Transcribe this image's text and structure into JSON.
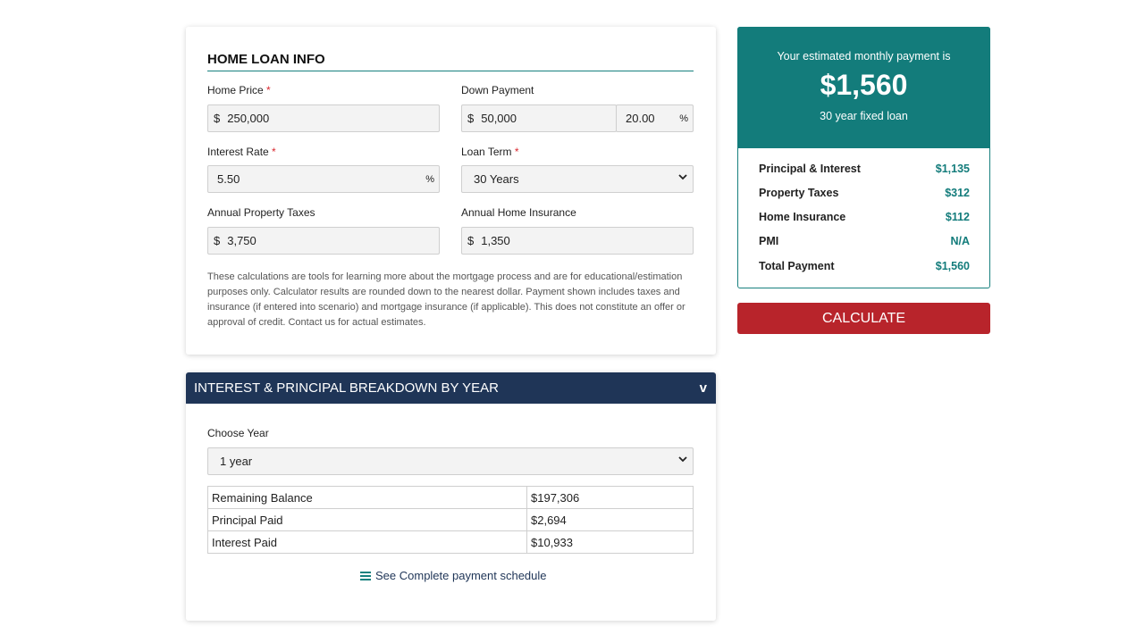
{
  "loan_info": {
    "title": "HOME LOAN INFO",
    "home_price": {
      "label": "Home Price",
      "required": "*",
      "prefix": "$",
      "value": "250,000"
    },
    "down_payment": {
      "label": "Down Payment",
      "prefix": "$",
      "value": "50,000",
      "percent_value": "20.00",
      "suffix": "%"
    },
    "interest_rate": {
      "label": "Interest Rate",
      "required": "*",
      "value": "5.50",
      "suffix": "%"
    },
    "loan_term": {
      "label": "Loan Term",
      "required": "*",
      "selected": "30 Years"
    },
    "property_taxes": {
      "label": "Annual Property Taxes",
      "prefix": "$",
      "value": "3,750"
    },
    "home_insurance": {
      "label": "Annual Home Insurance",
      "prefix": "$",
      "value": "1,350"
    },
    "disclaimer": "These calculations are tools for learning more about the mortgage process and are for educational/estimation purposes only. Calculator results are rounded down to the nearest dollar. Payment shown includes taxes and insurance (if entered into scenario) and mortgage insurance (if applicable). This does not constitute an offer or approval of credit. Contact us for actual estimates."
  },
  "breakdown": {
    "title": "INTEREST & PRINCIPAL BREAKDOWN BY YEAR",
    "toggle": "v",
    "year_label": "Choose Year",
    "year_selected": "1 year",
    "rows": [
      {
        "label": "Remaining Balance",
        "value": "$197,306"
      },
      {
        "label": "Principal Paid",
        "value": "$2,694"
      },
      {
        "label": "Interest Paid",
        "value": "$10,933"
      }
    ],
    "schedule_link": "See Complete payment schedule"
  },
  "summary": {
    "intro": "Your estimated monthly payment is",
    "amount": "$1,560",
    "term": "30 year fixed loan",
    "rows": [
      {
        "label": "Principal & Interest",
        "value": "$1,135"
      },
      {
        "label": "Property Taxes",
        "value": "$312"
      },
      {
        "label": "Home Insurance",
        "value": "$112"
      },
      {
        "label": "PMI",
        "value": "N/A"
      },
      {
        "label": "Total Payment",
        "value": "$1,560"
      }
    ]
  },
  "calculate_label": "CALCULATE",
  "icons": {
    "dropdown": "chevron-down-icon",
    "schedule": "list-icon"
  },
  "colors": {
    "teal": "#137c7b",
    "navy": "#1f3557",
    "red": "#b8242b",
    "required": "#d9282f"
  }
}
